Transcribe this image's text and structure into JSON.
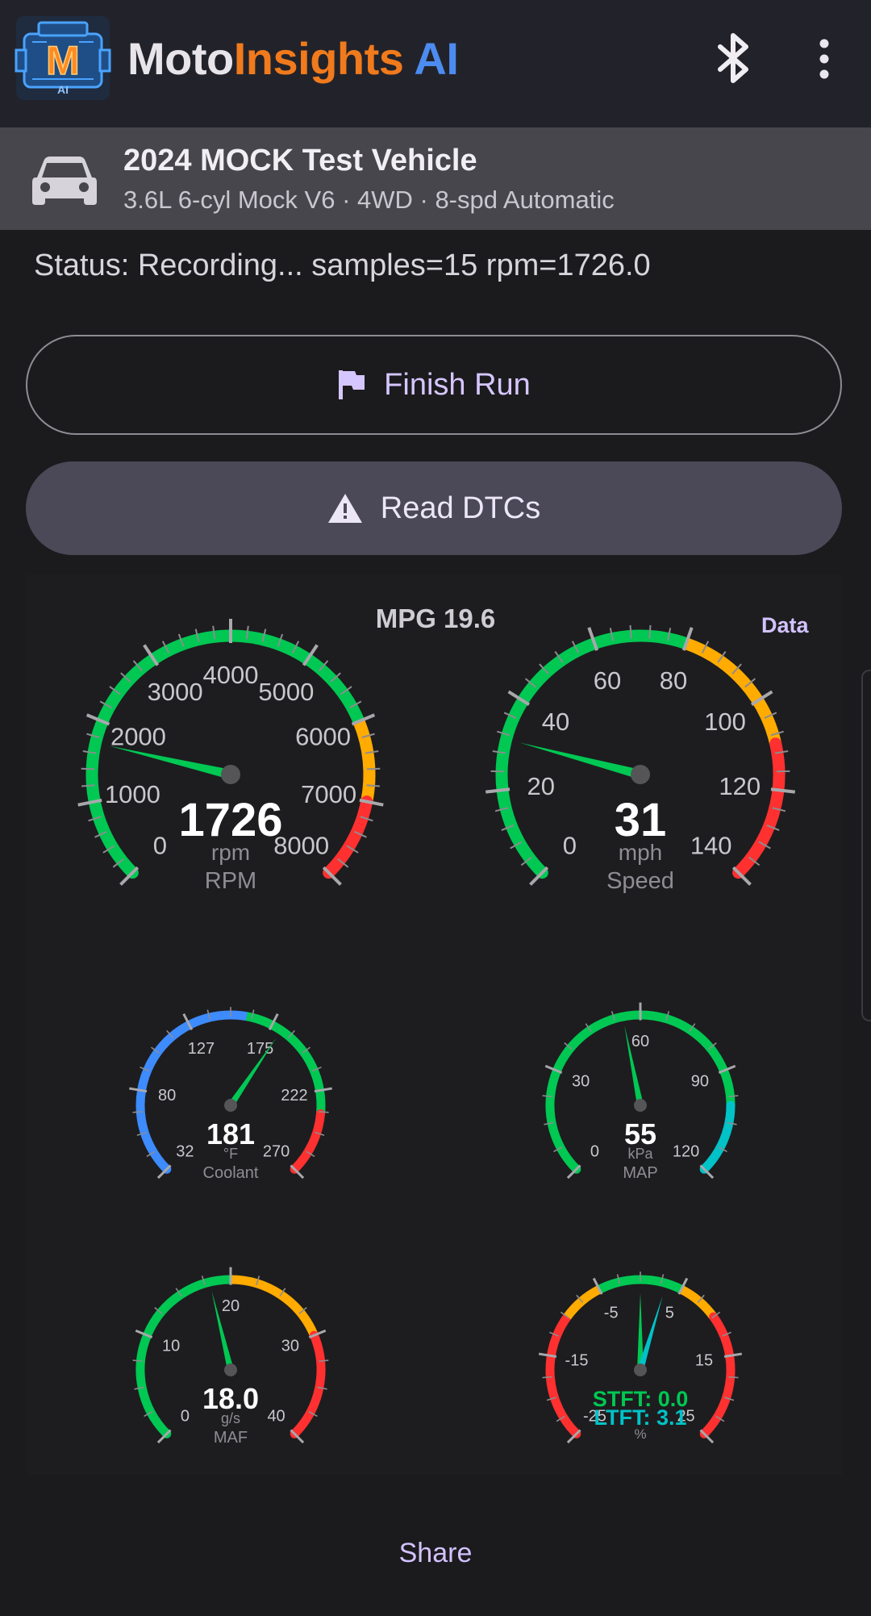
{
  "app": {
    "title_part1": "Moto",
    "title_part2": "Insights",
    "title_part3": "AI",
    "logo_letter": "M",
    "logo_sub": "AI"
  },
  "vehicle": {
    "name": "2024 MOCK Test Vehicle",
    "spec": "3.6L 6-cyl Mock V6 · 4WD · 8-spd Automatic"
  },
  "status": "Status: Recording... samples=15 rpm=1726.0",
  "buttons": {
    "finish_run": "Finish Run",
    "read_dtcs": "Read DTCs",
    "share": "Share",
    "data": "Data"
  },
  "mpg": "MPG 19.6",
  "colors": {
    "green": "#00c853",
    "orange": "#ffab00",
    "red": "#ff3030",
    "blue": "#3d8bfd",
    "cyan": "#00c2c7",
    "accent": "#d3c2ff"
  },
  "gauges": [
    {
      "id": "rpm",
      "label": "RPM",
      "unit": "rpm",
      "value": 1726,
      "display": "1726",
      "min": 0,
      "max": 8000,
      "ticks": [
        0,
        1000,
        2000,
        3000,
        4000,
        5000,
        6000,
        7000,
        8000
      ],
      "tick_labels": [
        "0",
        "1000",
        "2000",
        "3000",
        "4000",
        "5000",
        "6000",
        "7000",
        "8000"
      ],
      "minor_per_major": 4,
      "zones": [
        {
          "from": 0,
          "to": 6000,
          "color": "green"
        },
        {
          "from": 6000,
          "to": 7000,
          "color": "orange"
        },
        {
          "from": 7000,
          "to": 8000,
          "color": "red"
        }
      ],
      "needle_color": "green"
    },
    {
      "id": "speed",
      "label": "Speed",
      "unit": "mph",
      "value": 31,
      "display": "31",
      "min": 0,
      "max": 140,
      "ticks": [
        0,
        20,
        40,
        60,
        80,
        100,
        120,
        140
      ],
      "tick_labels": [
        "0",
        "20",
        "40",
        "60",
        "80",
        "100",
        "120",
        "140"
      ],
      "minor_per_major": 4,
      "zones": [
        {
          "from": 0,
          "to": 80,
          "color": "green"
        },
        {
          "from": 80,
          "to": 110,
          "color": "orange"
        },
        {
          "from": 110,
          "to": 140,
          "color": "red"
        }
      ],
      "needle_color": "green"
    },
    {
      "id": "coolant",
      "label": "Coolant",
      "unit": "°F",
      "value": 181,
      "display": "181",
      "min": 32,
      "max": 270,
      "ticks": [
        32,
        80,
        127,
        175,
        222,
        270
      ],
      "tick_labels": [
        "32",
        "80",
        "127",
        "175",
        "222",
        "270"
      ],
      "minor_per_major": 3,
      "zones": [
        {
          "from": 32,
          "to": 160,
          "color": "blue"
        },
        {
          "from": 160,
          "to": 235,
          "color": "green"
        },
        {
          "from": 235,
          "to": 270,
          "color": "red"
        }
      ],
      "needle_color": "green"
    },
    {
      "id": "map",
      "label": "MAP",
      "unit": "kPa",
      "value": 55,
      "display": "55",
      "min": 0,
      "max": 120,
      "ticks": [
        0,
        30,
        60,
        90,
        120
      ],
      "tick_labels": [
        "0",
        "30",
        "60",
        "90",
        "120"
      ],
      "minor_per_major": 3,
      "zones": [
        {
          "from": 0,
          "to": 100,
          "color": "green"
        },
        {
          "from": 100,
          "to": 120,
          "color": "cyan"
        }
      ],
      "needle_color": "green"
    },
    {
      "id": "maf",
      "label": "MAF",
      "unit": "g/s",
      "value": 18.0,
      "display": "18.0",
      "min": 0,
      "max": 40,
      "ticks": [
        0,
        10,
        20,
        30,
        40
      ],
      "tick_labels": [
        "0",
        "10",
        "20",
        "30",
        "40"
      ],
      "minor_per_major": 3,
      "zones": [
        {
          "from": 0,
          "to": 20,
          "color": "green"
        },
        {
          "from": 20,
          "to": 30,
          "color": "orange"
        },
        {
          "from": 30,
          "to": 40,
          "color": "red"
        }
      ],
      "needle_color": "green"
    },
    {
      "id": "fuel_trim",
      "label": "",
      "unit": "%",
      "min": -25,
      "max": 25,
      "ticks": [
        -25,
        -15,
        -5,
        5,
        15,
        25
      ],
      "tick_labels": [
        "-25",
        "-15",
        "-5",
        "5",
        "15",
        "25"
      ],
      "minor_per_major": 3,
      "zones": [
        {
          "from": -25,
          "to": -10,
          "color": "red"
        },
        {
          "from": -10,
          "to": -5,
          "color": "orange"
        },
        {
          "from": -5,
          "to": 5,
          "color": "green"
        },
        {
          "from": 5,
          "to": 10,
          "color": "orange"
        },
        {
          "from": 10,
          "to": 25,
          "color": "red"
        }
      ],
      "stft": 0.0,
      "ltft": 3.1,
      "stft_text": "STFT: 0.0",
      "ltft_text": "LTFT: 3.1"
    }
  ]
}
